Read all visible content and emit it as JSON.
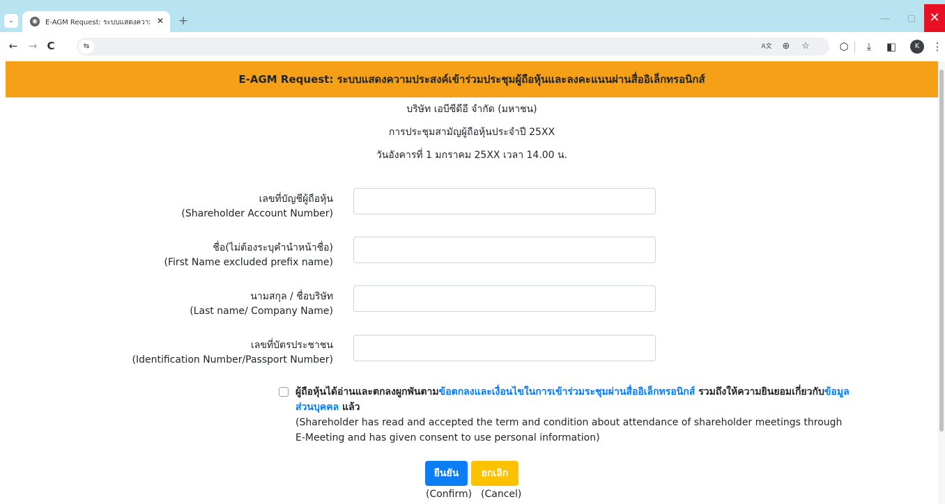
{
  "browser": {
    "tab_title": "E-AGM Request: ระบบแสดงความ",
    "tab_close": "✕",
    "new_tab": "+",
    "window_min": "—",
    "window_max": "▢",
    "window_close": "✕",
    "profile_initial": "K",
    "icons": {
      "back": "←",
      "forward": "→",
      "reload": "C",
      "site_info": "⇆",
      "translate": "A文",
      "zoom": "⊕",
      "bookmark": "☆",
      "extensions": "⬡",
      "download": "⤓",
      "side_panel": "◧",
      "menu": "⋮",
      "tab_list": "⌄",
      "favicon": "◉"
    }
  },
  "header": {
    "title": "E-AGM Request: ระบบแสดงความประสงค์เข้าร่วมประชุมผู้ถือหุ้นและลงคะแนนผ่านสื่ออิเล็กทรอนิกส์"
  },
  "meeting": {
    "company": "บริษัท เอบีซีดีอี จำกัด (มหาชน)",
    "meeting_name": "การประชุมสามัญผู้ถือหุ้นประจำปี 25XX",
    "meeting_date": "วันอังคารที่ 1 มกราคม 25XX เวลา 14.00 น."
  },
  "form": {
    "fields": [
      {
        "label_th": "เลขที่บัญชีผู้ถือหุ้น",
        "label_en": "(Shareholder Account Number)",
        "value": "",
        "placeholder": ""
      },
      {
        "label_th": "ชื่อ(ไม่ต้องระบุคำนำหน้าชื่อ)",
        "label_en": "(First Name excluded prefix name)",
        "value": "",
        "placeholder": ""
      },
      {
        "label_th": "นามสกุล / ชื่อบริษัท",
        "label_en": "(Last name/ Company Name)",
        "value": "",
        "placeholder": ""
      },
      {
        "label_th": "เลขที่บัตรประชาชน",
        "label_en": "(Identification Number/Passport Number)",
        "value": "",
        "placeholder": ""
      }
    ],
    "consent": {
      "checked": false,
      "text_1": "ผู้ถือหุ้นได้อ่านและตกลงผูกพันตาม",
      "link_terms": "ข้อตกลงและเงื่อนไขในการเข้าร่วมระชุมผ่านสื่ออิเล็กทรอนิกส์",
      "text_2": " รวมถึงให้ความยินยอมเกี่ยวกับ",
      "link_privacy": "ข้อมูลส่วนบุคคล",
      "text_3": " แล้ว",
      "english": "(Shareholder has read and accepted the term and condition about attendance of shareholder meetings through E-Meeting and has given consent to use personal information)"
    },
    "confirm_label": "ยืนยัน",
    "cancel_label": "ยกเลิก",
    "confirm_caption": "(Confirm)",
    "cancel_caption": "(Cancel)"
  },
  "colors": {
    "header_bg": "#f5a016",
    "confirm_bg": "#0d7df3",
    "cancel_bg": "#fcc200",
    "link": "#007bff"
  }
}
